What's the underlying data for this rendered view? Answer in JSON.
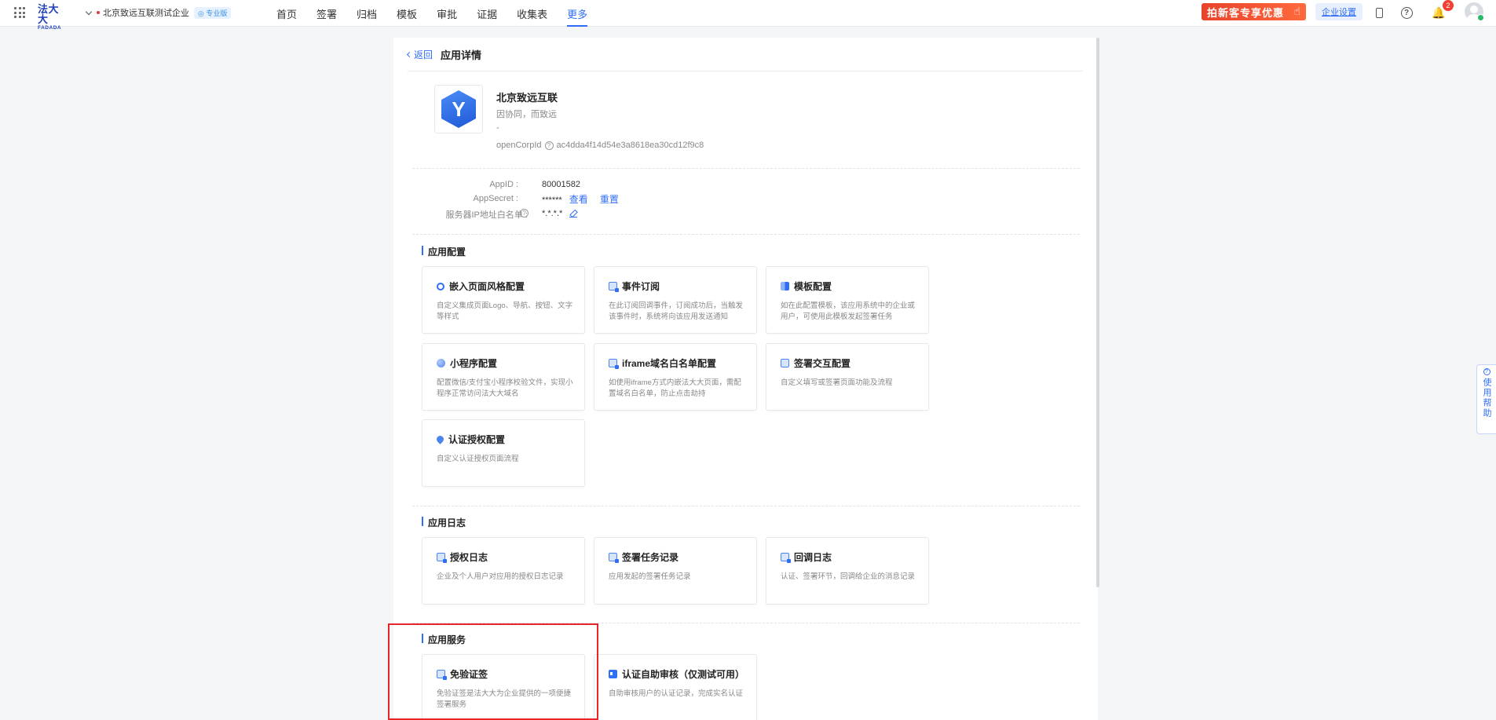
{
  "header": {
    "logo_cn": "法大大",
    "logo_en": "FADADA",
    "org_name": "北京致远互联测试企业",
    "org_tag": "专业版",
    "nav": [
      {
        "label": "首页",
        "active": false
      },
      {
        "label": "签署",
        "active": false
      },
      {
        "label": "归档",
        "active": false
      },
      {
        "label": "模板",
        "active": false
      },
      {
        "label": "审批",
        "active": false
      },
      {
        "label": "证据",
        "active": false
      },
      {
        "label": "收集表",
        "active": false
      },
      {
        "label": "更多",
        "active": true
      }
    ],
    "promo_label": "拍新客专享优惠",
    "enterprise_settings": "企业设置",
    "notification_count": "2"
  },
  "page": {
    "back": "返回",
    "title": "应用详情"
  },
  "app": {
    "logo_letter": "Y",
    "name": "北京致远互联",
    "slogan": "因协同，而致远",
    "dash": "-",
    "corp_label": "openCorpId",
    "corp_id": "ac4dda4f14d54e3a8618ea30cd12f9c8"
  },
  "credentials": {
    "appid_label": "AppID :",
    "appid": "80001582",
    "secret_label": "AppSecret :",
    "secret": "******",
    "view": "查看",
    "reset": "重置",
    "ip_label": "服务器IP地址白名单 :",
    "ip": "*.*.*.*"
  },
  "sections": {
    "config": {
      "title": "应用配置",
      "cards": [
        {
          "title": "嵌入页面风格配置",
          "desc": "自定义集成页面Logo、导航、按钮、文字等样式",
          "icon": "circle-icon"
        },
        {
          "title": "事件订阅",
          "desc": "在此订阅回调事件，订阅成功后，当触发该事件时，系统将向该应用发送通知",
          "icon": "document-icon"
        },
        {
          "title": "模板配置",
          "desc": "如在此配置模板，该应用系统中的企业或用户，可使用此模板发起签署任务",
          "icon": "template-icon"
        },
        {
          "title": "小程序配置",
          "desc": "配置微信/支付宝小程序校验文件，实现小程序正常访问法大大域名",
          "icon": "miniprogram-icon"
        },
        {
          "title": "iframe域名白名单配置",
          "desc": "如使用iframe方式内嵌法大大页面，需配置域名白名单，防止点击劫持",
          "icon": "document-icon"
        },
        {
          "title": "签署交互配置",
          "desc": "自定义填写或签署页面功能及流程",
          "icon": "mail-icon"
        },
        {
          "title": "认证授权配置",
          "desc": "自定义认证授权页面流程",
          "icon": "pin-icon"
        }
      ]
    },
    "logs": {
      "title": "应用日志",
      "cards": [
        {
          "title": "授权日志",
          "desc": "企业及个人用户对应用的授权日志记录",
          "icon": "document-icon"
        },
        {
          "title": "签署任务记录",
          "desc": "应用发起的签署任务记录",
          "icon": "document-icon"
        },
        {
          "title": "回调日志",
          "desc": "认证、签署环节，回调给企业的消息记录",
          "icon": "document-icon"
        }
      ]
    },
    "services": {
      "title": "应用服务",
      "cards": [
        {
          "title": "免验证签",
          "desc": "免验证签是法大大为企业提供的一项便捷签署服务",
          "icon": "document-icon"
        },
        {
          "title": "认证自助审核（仅测试可用）",
          "desc": "自助审核用户的认证记录，完成实名认证",
          "icon": "id-card-icon"
        }
      ]
    }
  },
  "help_float": "使用帮助",
  "colors": {
    "accent": "#2f6ef5",
    "highlight": "#e8262a",
    "promo": "#e8432b"
  }
}
